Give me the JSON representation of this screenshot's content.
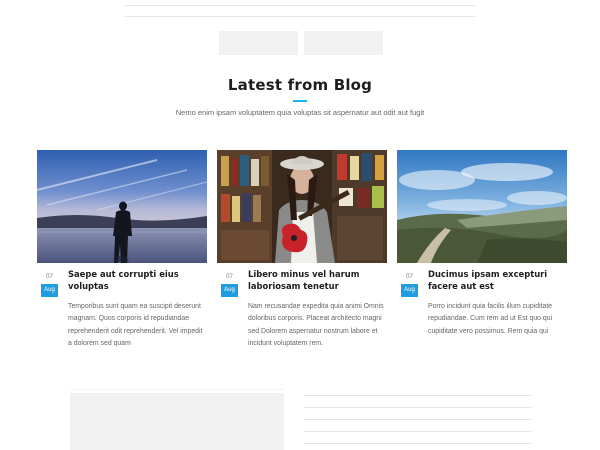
{
  "section": {
    "title": "Latest from Blog",
    "subtitle": "Nemo enim ipsam voluptatem quia voluptas sit aspernatur aut odit aut fugit"
  },
  "colors": {
    "accent": "#1eb2e6",
    "date_badge": "#1e9ee0",
    "placeholder_gray": "#f1f1f1"
  },
  "posts": [
    {
      "image": "silhouette-lake-photo",
      "day": "07",
      "month": "Aug",
      "title": "Saepe aut corrupti eius voluptas",
      "excerpt": "Temporibus sunt quam ea suscipit deserunt magnam. Quos corporis id repudiandae reprehenderit odit reprehenderit. Vel impedit a dolorem sed quam"
    },
    {
      "image": "guitarist-record-store-photo",
      "day": "07",
      "month": "Aug",
      "title": "Libero minus vel harum laboriosam tenetur",
      "excerpt": "Nam recusandae expedita quia animi Omnis doloribus corporis. Placeat architecto magni sed Dolorem aspernatur nostrum labore et incidunt voluptatem rem."
    },
    {
      "image": "coastal-road-landscape-photo",
      "day": "07",
      "month": "Aug",
      "title": "Ducimus ipsam excepturi facere aut est",
      "excerpt": "Porro incidunt quia facilis illum cupiditate repudiandae. Cum rem ad ut Est quo qui cupiditate vero possimus. Rem quia qui"
    }
  ]
}
